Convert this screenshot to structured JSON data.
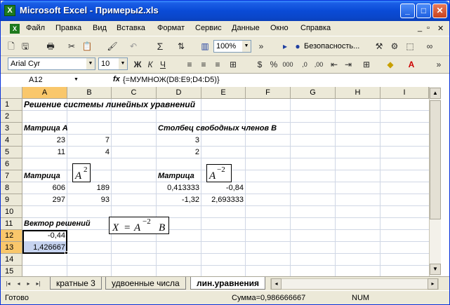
{
  "window": {
    "title": "Microsoft Excel - Примеры2.xls",
    "icon_letter": "X"
  },
  "menu": [
    "Файл",
    "Правка",
    "Вид",
    "Вставка",
    "Формат",
    "Сервис",
    "Данные",
    "Окно",
    "Справка"
  ],
  "toolbar": {
    "zoom": "100%",
    "security_label": "Безопасность...",
    "font_name": "Arial Cyr",
    "font_size": "10",
    "sum_glyph": "Σ",
    "percent": "%",
    "thousands": "000"
  },
  "formula_bar": {
    "name_box": "A12",
    "fx": "fx",
    "formula": "{=МУМНОЖ(D8:E9;D4:D5)}"
  },
  "columns": [
    "A",
    "B",
    "C",
    "D",
    "E",
    "F",
    "G",
    "H",
    "I"
  ],
  "rows": [
    "1",
    "2",
    "3",
    "4",
    "5",
    "6",
    "7",
    "8",
    "9",
    "10",
    "11",
    "12",
    "13",
    "14",
    "15"
  ],
  "cells": {
    "A1": "Решение системы линейных уравнений",
    "A3": "Матрица А",
    "D3": "Столбец свободных членов В",
    "A4": "23",
    "B4": "7",
    "D4": "3",
    "A5": "11",
    "B5": "4",
    "D5": "2",
    "A7": "Матрица",
    "D7": "Матрица",
    "A8": "606",
    "B8": "189",
    "D8": "0,413333",
    "E8": "-0,84",
    "A9": "297",
    "B9": "93",
    "D9": "-1,32",
    "E9": "2,693333",
    "A11": "Вектор решений",
    "A12": "-0,44",
    "A13": "1,426667"
  },
  "equations": {
    "a_squared": {
      "base": "A",
      "exp": "2"
    },
    "a_inv_squared": {
      "base": "A",
      "exp": "−2"
    },
    "solution": {
      "lhs": "X",
      "eq": "=",
      "base": "A",
      "exp": "−2",
      "tail": "B"
    }
  },
  "sheet_tabs": [
    {
      "label": "кратные 3",
      "active": false
    },
    {
      "label": "удвоенные числа",
      "active": false
    },
    {
      "label": "лин.уравнения",
      "active": true
    }
  ],
  "status": {
    "ready": "Готово",
    "sum": "Сумма=0,986666667",
    "num": "NUM"
  }
}
